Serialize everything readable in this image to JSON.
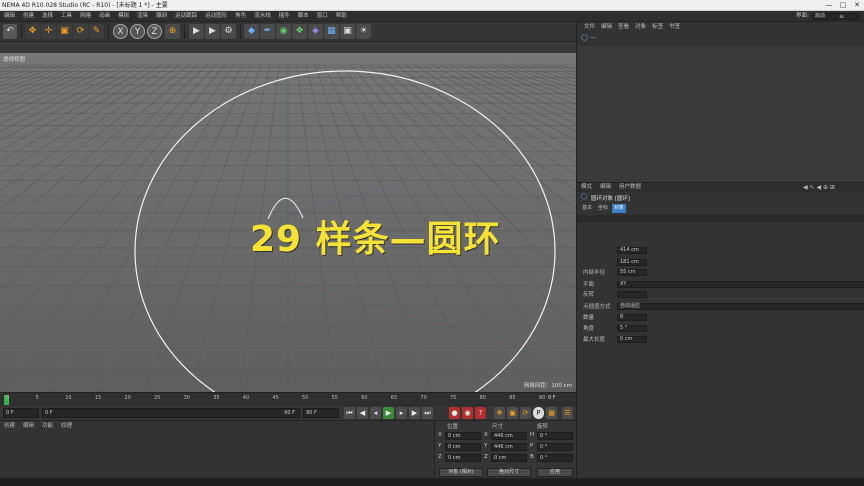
{
  "titlebar": {
    "title": "NEMA 4D R10.028 Studio (RC - R10) - [未标题 1 *] - 主要",
    "min": "—",
    "max": "□",
    "close": "✕"
  },
  "menu": {
    "items": [
      "编辑",
      "创建",
      "选择",
      "工具",
      "网格",
      "动画",
      "模拟",
      "渲染",
      "雕刻",
      "运动跟踪",
      "运动图形",
      "角色",
      "流水线",
      "插件",
      "脚本",
      "窗口",
      "帮助"
    ]
  },
  "layout": {
    "label": "界面:",
    "value": "启动"
  },
  "toolbar": {
    "xyz": [
      "X",
      "Y",
      "Z"
    ]
  },
  "viewport": {
    "menu": [
      "查看",
      "摄像机",
      "显示",
      "选项",
      "过滤",
      "面板"
    ],
    "title": "透视视图",
    "grid_info": "网格间距：100 cm",
    "overlay": "29 样条—圆环"
  },
  "timeline": {
    "ticks": [
      "0",
      "5",
      "10",
      "15",
      "20",
      "25",
      "30",
      "35",
      "40",
      "45",
      "50",
      "55",
      "60",
      "65",
      "70",
      "75",
      "80",
      "85",
      "90"
    ],
    "end_label": "0 F"
  },
  "framebar": {
    "start": "0 F",
    "current": "0 F",
    "end": "90 F",
    "end2": "90 F"
  },
  "matmgr": {
    "menu": [
      "创建",
      "编辑",
      "功能",
      "纹理"
    ]
  },
  "coords": {
    "headers": [
      "位置",
      "尺寸",
      "旋转"
    ],
    "rows": [
      {
        "axis": "X",
        "pos": "0 cm",
        "size_axis": "X",
        "size": "446 cm",
        "rot_axis": "H",
        "rot": "0 °"
      },
      {
        "axis": "Y",
        "pos": "0 cm",
        "size_axis": "Y",
        "size": "446 cm",
        "rot_axis": "P",
        "rot": "0 °"
      },
      {
        "axis": "Z",
        "pos": "0 cm",
        "size_axis": "Z",
        "size": "0 cm",
        "rot_axis": "B",
        "rot": "0 °"
      }
    ],
    "mode": "对象 (相对)",
    "size_mode": "绝对尺寸",
    "apply": "应用"
  },
  "objmgr": {
    "menu": [
      "文件",
      "编辑",
      "查看",
      "对象",
      "标签",
      "书签"
    ]
  },
  "attrmgr": {
    "menu": [
      "模式",
      "编辑",
      "用户数据"
    ],
    "object_name": "圆环对象 [圆环]",
    "tabs": [
      "基本",
      "坐标",
      "对象"
    ],
    "fields": [
      {
        "label": "",
        "value": "414 cm"
      },
      {
        "label": "",
        "value": "181 cm"
      },
      {
        "label": "内部半径",
        "value": "55 cm"
      },
      {
        "label": "平面",
        "value": "XY"
      },
      {
        "label": "反转",
        "value": ""
      },
      {
        "label": "点插值方式",
        "value": "自动适应"
      },
      {
        "label": "数量",
        "value": "8"
      },
      {
        "label": "角度",
        "value": "5 °"
      },
      {
        "label": "最大长度",
        "value": "0 cm"
      }
    ]
  },
  "colors": {
    "accent": "#3b7fc4",
    "overlay": "#f5e234",
    "viewport_bg": "#676767",
    "panel": "#333333"
  }
}
